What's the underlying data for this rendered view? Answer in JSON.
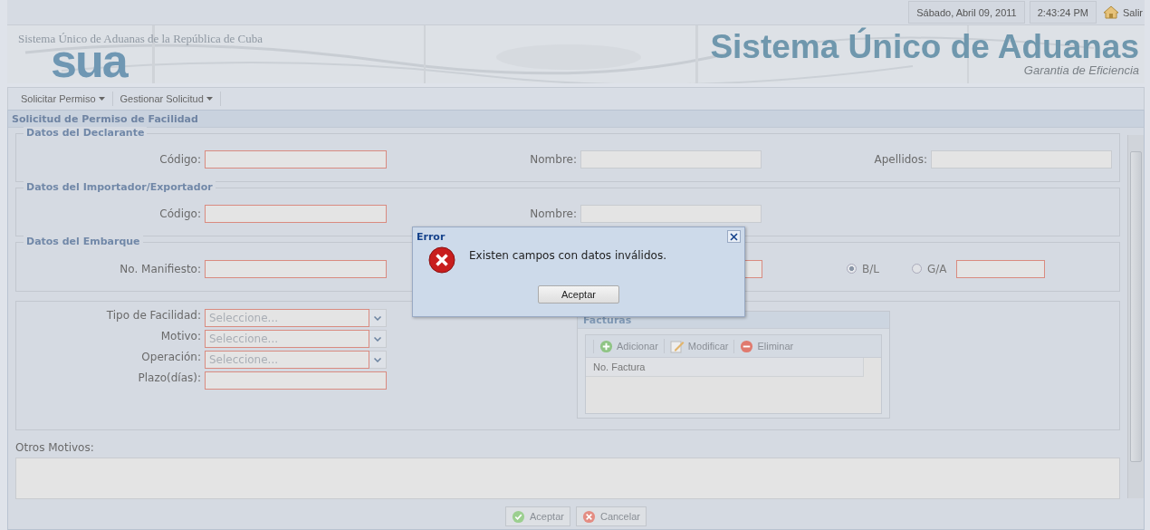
{
  "topbar": {
    "date": "Sábado, Abril 09, 2011",
    "time": "2:43:24 PM",
    "logout": "Salir"
  },
  "header": {
    "caption": "Sistema Único de Aduanas de la República de Cuba",
    "logo": "sua",
    "title": "Sistema Único de Aduanas",
    "slogan": "Garantia de Eficiencia"
  },
  "menu": [
    {
      "label": "Solicitar Permiso"
    },
    {
      "label": "Gestionar Solicitud"
    }
  ],
  "panel_title": "Solicitud de Permiso de Facilidad",
  "sections": [
    {
      "legend": "Datos del Declarante",
      "fields": [
        {
          "label": "Código:",
          "invalid": true
        },
        {
          "label": "Nombre:",
          "invalid": false
        },
        {
          "label": "Apellidos:",
          "invalid": false
        }
      ]
    },
    {
      "legend": "Datos del Importador/Exportador",
      "fields": [
        {
          "label": "Código:",
          "invalid": true
        },
        {
          "label": "Nombre:",
          "invalid": false
        }
      ]
    }
  ],
  "shipment": {
    "legend": "Datos del Embarque",
    "fields": [
      {
        "label": "No. Manifiesto:",
        "invalid": true
      },
      {
        "invalid": true
      }
    ],
    "radios": [
      {
        "label": "B/L",
        "selected": true
      },
      {
        "label": "G/A",
        "selected": false
      }
    ],
    "radio_field": {
      "invalid": true
    }
  },
  "facility": [
    {
      "kind": "combo",
      "label": "Tipo de Facilidad:",
      "placeholder": "Seleccione...",
      "invalid": true
    },
    {
      "kind": "combo",
      "label": "Motivo:",
      "placeholder": "Seleccione...",
      "invalid": true
    },
    {
      "kind": "combo",
      "label": "Operación:",
      "placeholder": "Seleccione...",
      "invalid": true
    },
    {
      "kind": "text",
      "label": "Plazo(días):",
      "invalid": true
    }
  ],
  "invoices": {
    "title": "Facturas",
    "tools": [
      {
        "kind": "add",
        "label": "Adicionar"
      },
      {
        "kind": "edit",
        "label": "Modificar"
      },
      {
        "kind": "remove",
        "label": "Eliminar"
      }
    ],
    "columns": [
      "No. Factura"
    ]
  },
  "other_reasons": {
    "label": "Otros Motivos:"
  },
  "buttons": [
    {
      "kind": "ok",
      "label": "Aceptar"
    },
    {
      "kind": "cancel",
      "label": "Cancelar"
    }
  ],
  "dialog": {
    "title": "Error",
    "message": "Existen campos con datos inválidos.",
    "button": "Aceptar"
  }
}
